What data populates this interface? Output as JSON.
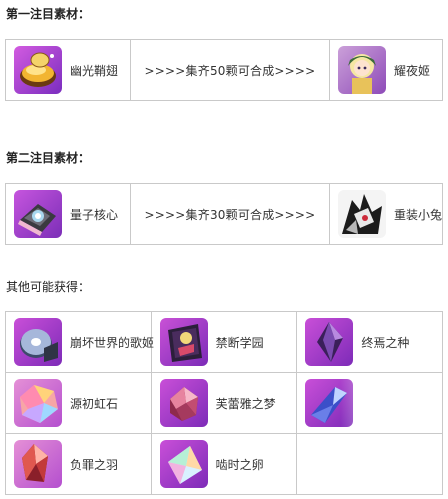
{
  "section1": {
    "title": "第一注目素材：",
    "source": {
      "name": "幽光鞘翅",
      "icon": "golden-beetle-shell-icon"
    },
    "arrow": ">>>>集齐50颗可合成>>>>",
    "result": {
      "name": "耀夜姬",
      "icon": "yaoyeji-character-icon"
    }
  },
  "section2": {
    "title": "第二注目素材：",
    "source": {
      "name": "量子核心",
      "icon": "quantum-core-icon"
    },
    "arrow": ">>>>集齐30颗可合成>>>>",
    "result": {
      "name": "重装小兔",
      "icon": "heavy-bunny-mech-icon"
    }
  },
  "section3": {
    "title": "其他可能获得：",
    "items": [
      {
        "name": "崩坏世界的歌姬",
        "icon": "disc-icon"
      },
      {
        "name": "禁断学园",
        "icon": "forbidden-academy-icon"
      },
      {
        "name": "终焉之种",
        "icon": "purple-crystal-icon"
      },
      {
        "name": "源初虹石",
        "icon": "rainbow-stone-icon"
      },
      {
        "name": "芙蕾雅之梦",
        "icon": "pink-gem-icon"
      },
      {
        "name": "",
        "icon": "blue-crystal-icon"
      },
      {
        "name": "负罪之羽",
        "icon": "red-crystal-icon"
      },
      {
        "name": "啮时之卵",
        "icon": "prism-crystal-icon"
      }
    ]
  },
  "colors": {
    "border": "#c9c9c9",
    "icon_bg_purple": "#9b34c9",
    "icon_bg_pink": "#e06fc9"
  }
}
